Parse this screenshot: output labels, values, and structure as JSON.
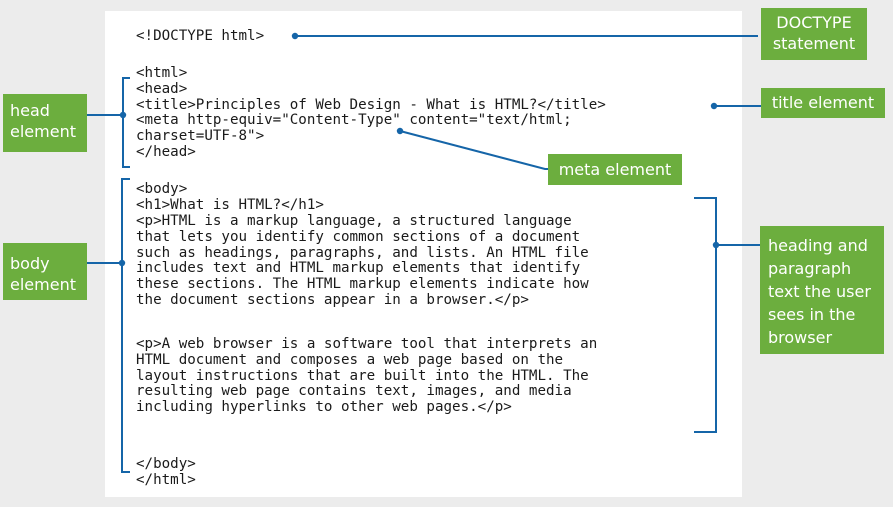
{
  "code": {
    "doctype": "<!DOCTYPE html>",
    "head_block": "<html>\n<head>\n<title>Principles of Web Design - What is HTML?</title>\n<meta http-equiv=\"Content-Type\" content=\"text/html;\ncharset=UTF-8\">\n</head>",
    "body_open": "<body>",
    "h1": "<h1>What is HTML?</h1>",
    "para1": "<p>HTML is a markup language, a structured language\nthat lets you identify common sections of a document\nsuch as headings, paragraphs, and lists. An HTML file\nincludes text and HTML markup elements that identify\nthese sections. The HTML markup elements indicate how\nthe document sections appear in a browser.</p>",
    "para2": "<p>A web browser is a software tool that interprets an\nHTML document and composes a web page based on the\nlayout instructions that are built into the HTML. The\nresulting web page contains text, images, and media\nincluding hyperlinks to other web pages.</p>",
    "closing": "</body>\n</html>"
  },
  "labels": {
    "doctype": "DOCTYPE\nstatement",
    "title": "title element",
    "meta": "meta element",
    "head": "head\nelement",
    "body": "body\nelement",
    "text": "heading and\nparagraph\ntext the user\nsees in the\nbrowser"
  },
  "colors": {
    "label_bg": "#6cae3e",
    "label_text": "#ffffff",
    "connector": "#1565a8",
    "panel": "#ffffff",
    "page": "#ececec"
  }
}
